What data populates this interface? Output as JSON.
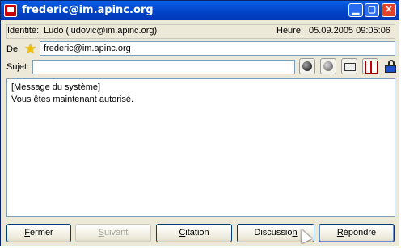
{
  "window": {
    "title": "frederic@im.apinc.org",
    "minimize": "▁",
    "maximize": "▢",
    "close": "✕"
  },
  "identity": {
    "label": "Identité:",
    "value": "Ludo (ludovic@im.apinc.org)"
  },
  "time": {
    "label": "Heure:",
    "value": "05.09.2005 09:05:06"
  },
  "from": {
    "label": "De:",
    "value": "frederic@im.apinc.org",
    "icon": "star-icon"
  },
  "subject": {
    "label": "Sujet:",
    "value": ""
  },
  "toolbar_icons": [
    "smiley-icon",
    "color-ball-icon",
    "keyboard-icon",
    "book-icon",
    "lock-icon"
  ],
  "message": {
    "line1": "[Message du système]",
    "line2": "Vous êtes maintenant autorisé."
  },
  "buttons": {
    "close": {
      "underline": "F",
      "rest": "ermer"
    },
    "next": {
      "underline": "S",
      "rest": "uivant"
    },
    "quote": {
      "underline": "C",
      "rest": "itation"
    },
    "chat": {
      "pre": "Discussio",
      "underline": "n"
    },
    "reply": {
      "underline": "R",
      "rest": "épondre"
    }
  }
}
